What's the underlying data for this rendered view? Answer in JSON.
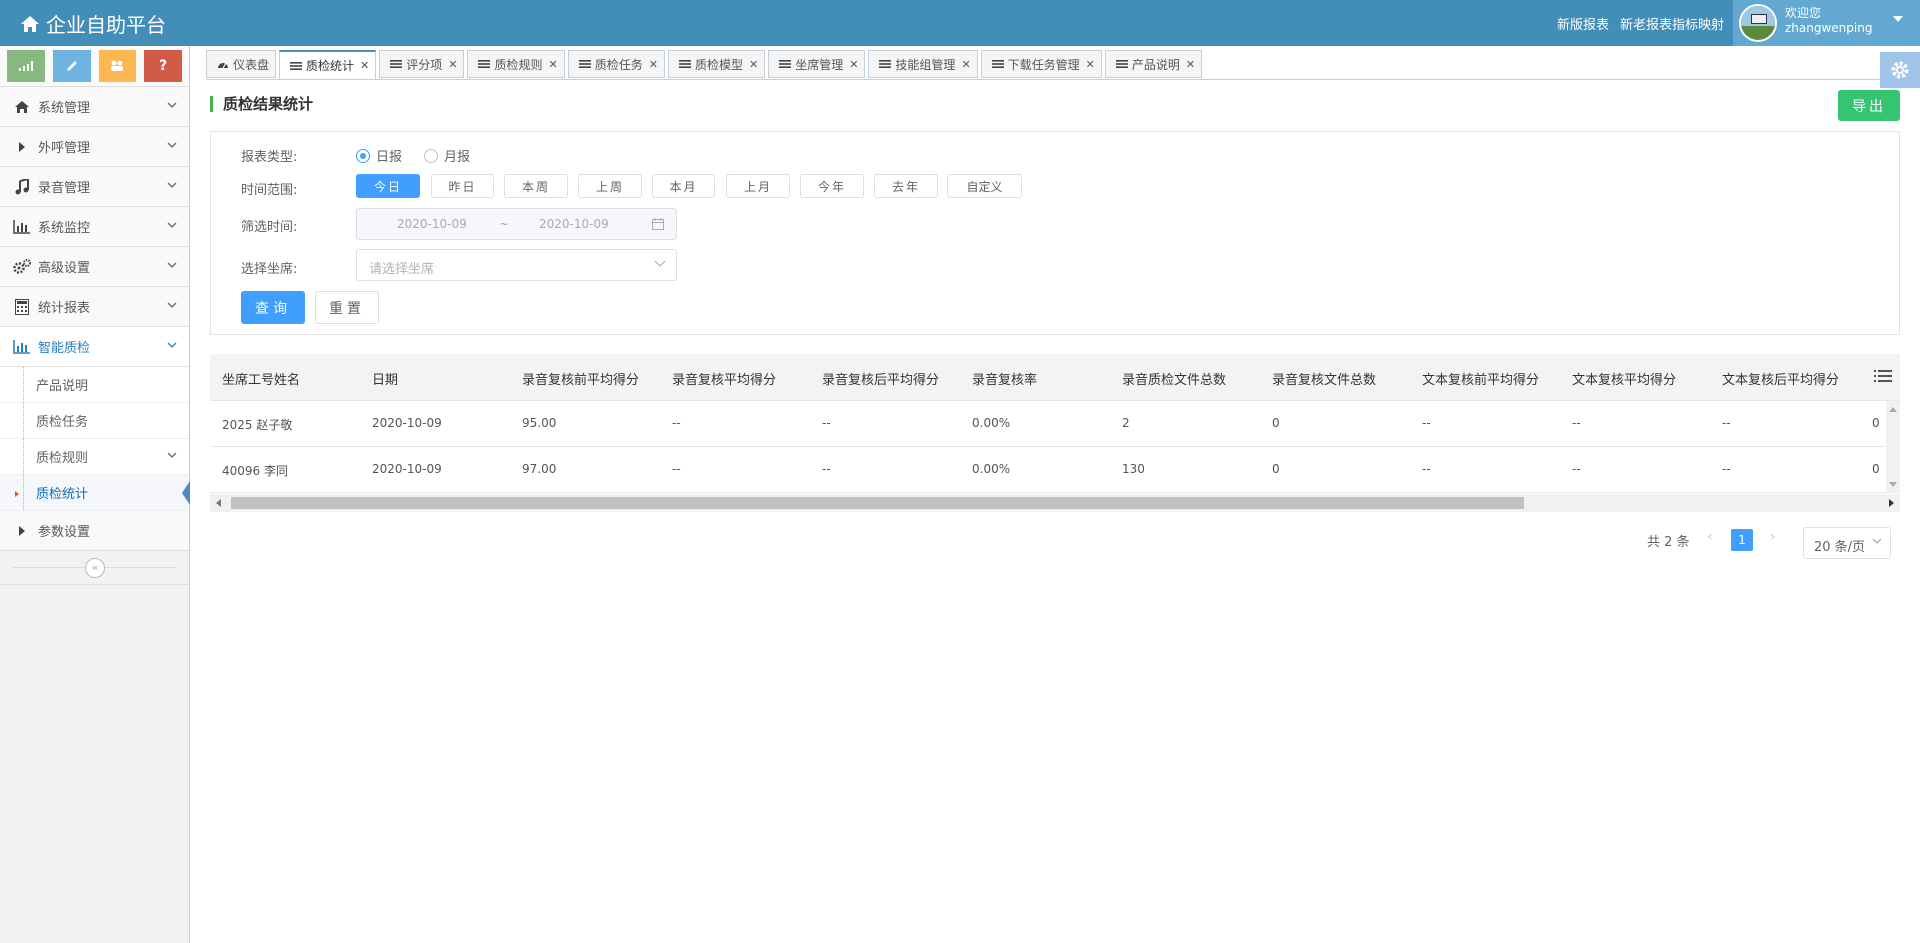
{
  "header": {
    "brand": "企业自助平台",
    "links": [
      "新版报表",
      "新老报表指标映射"
    ],
    "user": {
      "greeting": "欢迎您",
      "name": "zhangwenping"
    }
  },
  "sidebar": {
    "shortcuts": [
      {
        "icon": "signal-icon",
        "color": "#87b87f"
      },
      {
        "icon": "pencil-icon",
        "color": "#6fb3e0"
      },
      {
        "icon": "users-icon",
        "color": "#ffb752"
      },
      {
        "icon": "question-icon",
        "color": "#d15b47",
        "label": "?"
      }
    ],
    "items": [
      {
        "label": "系统管理",
        "icon": "home-icon"
      },
      {
        "label": "外呼管理",
        "icon": "caret-right-icon"
      },
      {
        "label": "录音管理",
        "icon": "music-icon"
      },
      {
        "label": "系统监控",
        "icon": "bar-chart-icon"
      },
      {
        "label": "高级设置",
        "icon": "cogs-icon"
      },
      {
        "label": "统计报表",
        "icon": "calculator-icon"
      },
      {
        "label": "智能质检",
        "icon": "bar-chart-icon"
      }
    ],
    "subitems": [
      "产品说明",
      "质检任务",
      "质检规则",
      "质检统计"
    ],
    "last_item": "参数设置"
  },
  "tabs": [
    {
      "label": "仪表盘",
      "icon": "dashboard-icon",
      "closable": false
    },
    {
      "label": "质检统计",
      "icon": "list-icon",
      "closable": true
    },
    {
      "label": "评分项",
      "icon": "list-icon",
      "closable": true
    },
    {
      "label": "质检规则",
      "icon": "list-icon",
      "closable": true
    },
    {
      "label": "质检任务",
      "icon": "list-icon",
      "closable": true
    },
    {
      "label": "质检模型",
      "icon": "list-icon",
      "closable": true
    },
    {
      "label": "坐席管理",
      "icon": "list-icon",
      "closable": true
    },
    {
      "label": "技能组管理",
      "icon": "list-icon",
      "closable": true
    },
    {
      "label": "下载任务管理",
      "icon": "list-icon",
      "closable": true
    },
    {
      "label": "产品说明",
      "icon": "list-icon",
      "closable": true
    }
  ],
  "main": {
    "title": "质检结果统计",
    "export_label": "导出",
    "filter": {
      "report_type_label": "报表类型:",
      "report_types": [
        "日报",
        "月报"
      ],
      "time_range_label": "时间范围:",
      "time_ranges": [
        "今日",
        "昨日",
        "本周",
        "上周",
        "本月",
        "上月",
        "今年",
        "去年",
        "自定义"
      ],
      "filter_time_label": "筛选时间:",
      "date_start": "2020-10-09",
      "date_sep": "~",
      "date_end": "2020-10-09",
      "agent_label": "选择坐席:",
      "agent_placeholder": "请选择坐席",
      "query_label": "查询",
      "reset_label": "重置"
    },
    "table": {
      "columns": [
        "坐席工号姓名",
        "日期",
        "录音复核前平均得分",
        "录音复核平均得分",
        "录音复核后平均得分",
        "录音复核率",
        "录音质检文件总数",
        "录音复核文件总数",
        "文本复核前平均得分",
        "文本复核平均得分",
        "文本复核后平均得分"
      ],
      "rows": [
        [
          "2025 赵子敬",
          "2020-10-09",
          "95.00",
          "--",
          "--",
          "0.00%",
          "2",
          "0",
          "--",
          "--",
          "--",
          "0"
        ],
        [
          "40096 李同",
          "2020-10-09",
          "97.00",
          "--",
          "--",
          "0.00%",
          "130",
          "0",
          "--",
          "--",
          "--",
          "0"
        ]
      ]
    },
    "pager": {
      "total": "共 2 条",
      "current": "1",
      "size": "20 条/页"
    }
  }
}
